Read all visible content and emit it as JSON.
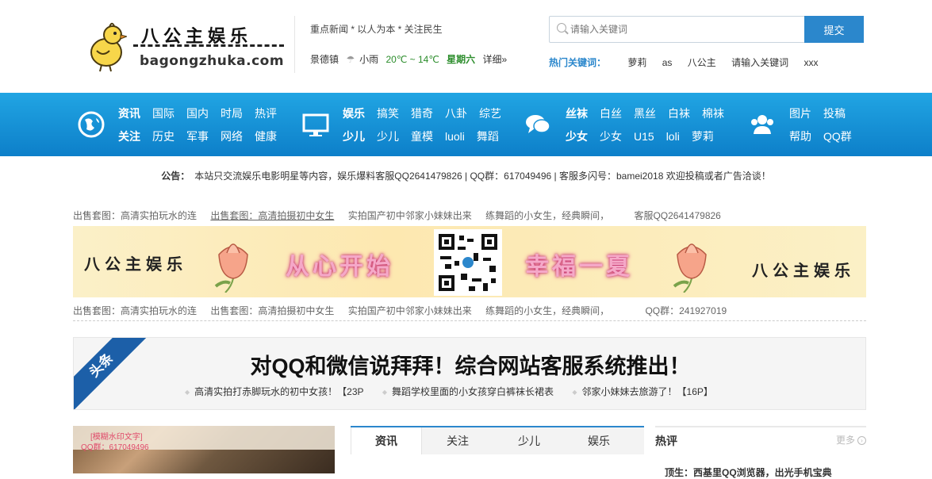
{
  "header": {
    "logo_title": "八公主娱乐",
    "logo_domain": "bagongzhuka.com",
    "tagline": "重点新闻 * 以人为本 * 关注民生",
    "weather": {
      "city": "景德镇",
      "condition": "小雨",
      "temp": "20℃ ~ 14℃",
      "day": "星期六",
      "more": "详细»"
    },
    "search": {
      "placeholder": "请输入关键词",
      "button": "提交"
    },
    "hot_keywords": {
      "label": "热门关键词：",
      "items": [
        "萝莉",
        "as",
        "八公主",
        "请输入关键词",
        "xxx"
      ]
    }
  },
  "nav": {
    "groups": [
      {
        "icon": "globe-icon",
        "row1": [
          "资讯",
          "国际",
          "国内",
          "时局",
          "热评"
        ],
        "row2": [
          "关注",
          "历史",
          "军事",
          "网络",
          "健康"
        ]
      },
      {
        "icon": "monitor-icon",
        "row1": [
          "娱乐",
          "搞笑",
          "猎奇",
          "八卦",
          "综艺"
        ],
        "row2": [
          "少儿",
          "少儿",
          "童模",
          "luoli",
          "舞蹈"
        ]
      },
      {
        "icon": "chat-icon",
        "row1": [
          "丝袜",
          "白丝",
          "黑丝",
          "白袜",
          "棉袜"
        ],
        "row2": [
          "少女",
          "少女",
          "U15",
          "loli",
          "萝莉"
        ]
      },
      {
        "icon": "users-icon",
        "row1": [
          "图片",
          "投稿"
        ],
        "row2": [
          "帮助",
          "QQ群"
        ]
      }
    ]
  },
  "notice": {
    "label": "公告：",
    "text": "本站只交流娱乐电影明星等内容，娱乐爆料客服QQ2641479826 | QQ群：617049496 | 客服多闪号：bamei2018 欢迎投稿或者广告洽谈！"
  },
  "link_row_1": [
    "出售套图：高清实拍玩水的连",
    "出售套图：高清拍摄初中女生",
    "实拍国产初中邻家小妹妹出来",
    "练舞蹈的小女生，经典瞬间，",
    "客服QQ2641479826"
  ],
  "link_row_2": [
    "出售套图：高清实拍玩水的连",
    "出售套图：高清拍摄初中女生",
    "实拍国产初中邻家小妹妹出来",
    "练舞蹈的小女生，经典瞬间，",
    "QQ群：241927019"
  ],
  "banner": {
    "brand_left": "八公主娱乐",
    "slogan_1": "从心开始",
    "slogan_2": "幸福一夏",
    "brand_right": "八公主娱乐"
  },
  "headline": {
    "ribbon": "头条",
    "title": "对QQ和微信说拜拜！综合网站客服系统推出！",
    "links": [
      "高清实拍打赤脚玩水的初中女孩！【23P",
      "舞蹈学校里面的小女孩穿白裤袜长裙表",
      "邻家小妹妹去旅游了！【16P】"
    ]
  },
  "photo": {
    "caption_1": "[模糊水印文字]",
    "caption_2": "QQ群：617049496"
  },
  "tabs": [
    "资讯",
    "关注",
    "少儿",
    "娱乐"
  ],
  "hot": {
    "title": "热评",
    "more": "更多",
    "first_line": "顶生：西基里QQ浏览器，出光手机宝典"
  }
}
